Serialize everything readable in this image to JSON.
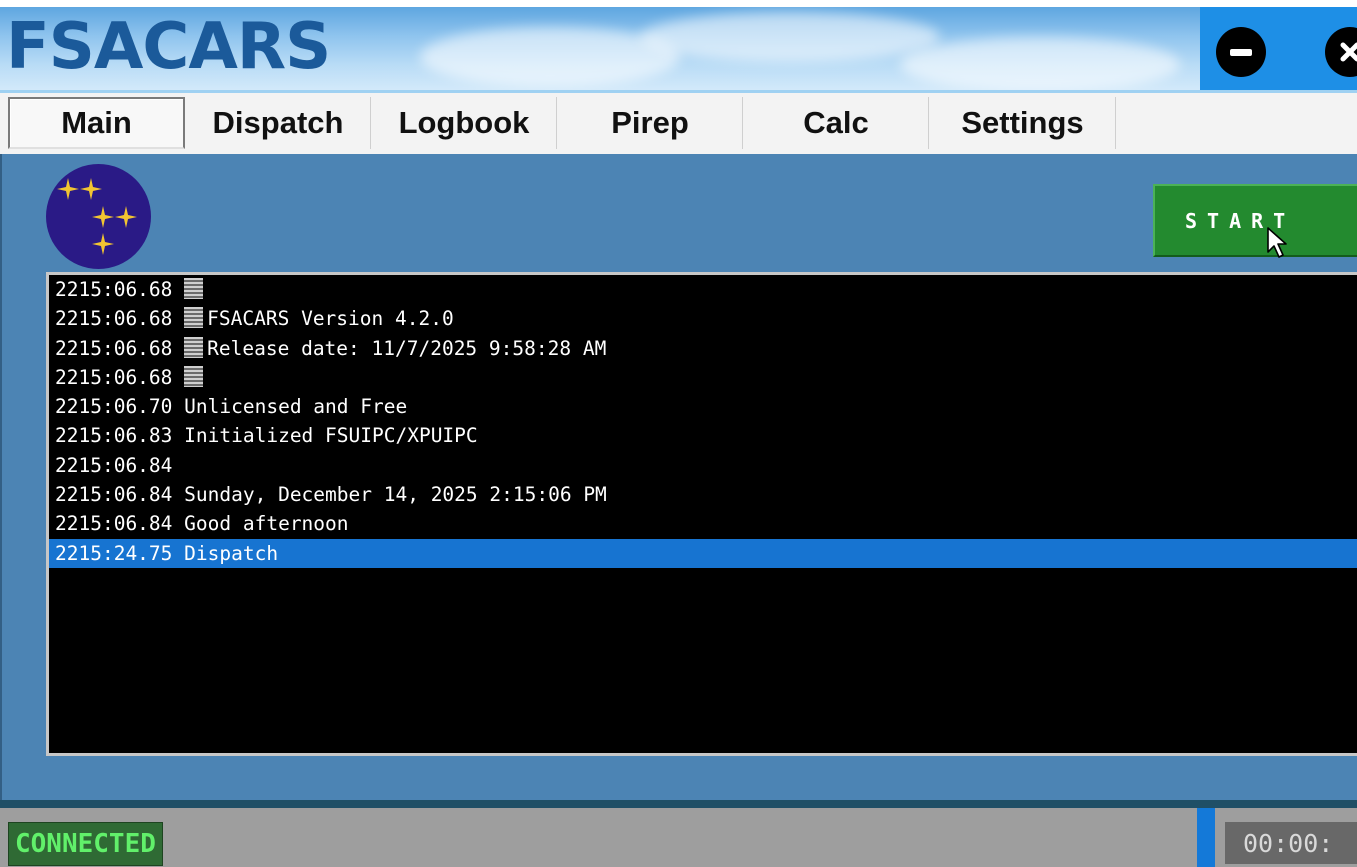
{
  "app": {
    "title": "FSACARS"
  },
  "tabs": [
    {
      "label": "Main",
      "active": true
    },
    {
      "label": "Dispatch",
      "active": false
    },
    {
      "label": "Logbook",
      "active": false
    },
    {
      "label": "Pirep",
      "active": false
    },
    {
      "label": "Calc",
      "active": false
    },
    {
      "label": "Settings",
      "active": false
    }
  ],
  "main": {
    "start_label": "START"
  },
  "log": [
    {
      "time": "2215:06.68",
      "block": true,
      "text": ""
    },
    {
      "time": "2215:06.68",
      "block": true,
      "text": "FSACARS Version 4.2.0"
    },
    {
      "time": "2215:06.68",
      "block": true,
      "text": "Release date: 11/7/2025 9:58:28 AM"
    },
    {
      "time": "2215:06.68",
      "block": true,
      "text": ""
    },
    {
      "time": "2215:06.70",
      "block": false,
      "text": "Unlicensed and Free"
    },
    {
      "time": "2215:06.83",
      "block": false,
      "text": "Initialized FSUIPC/XPUIPC"
    },
    {
      "time": "2215:06.84",
      "block": false,
      "text": ""
    },
    {
      "time": "2215:06.84",
      "block": false,
      "text": "Sunday, December 14, 2025 2:15:06 PM"
    },
    {
      "time": "2215:06.84",
      "block": false,
      "text": "Good afternoon"
    },
    {
      "time": "2215:24.75",
      "block": false,
      "text": "Dispatch",
      "selected": true
    }
  ],
  "status": {
    "connection": "CONNECTED",
    "timer": "00:00:"
  },
  "colors": {
    "header_title": "#1b5a9a",
    "start_button": "#238a2f",
    "log_selection": "#1774d1",
    "connected_text": "#61f06a"
  },
  "icons": {
    "minimize": "minimize-icon",
    "close": "close-icon",
    "logo": "stars-logo-icon",
    "cursor": "mouse-cursor-icon"
  }
}
